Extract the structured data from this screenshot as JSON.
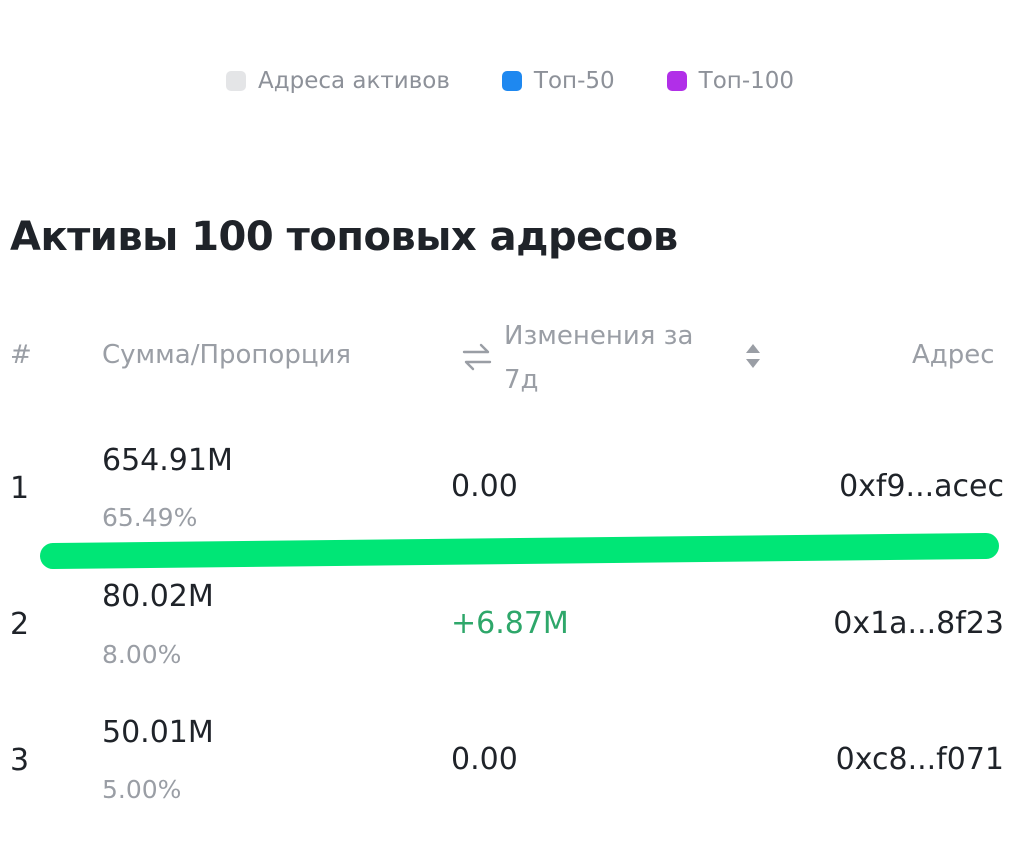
{
  "legend": {
    "items": [
      {
        "label": "Адреса активов",
        "color": "#e4e5e7"
      },
      {
        "label": "Топ-50",
        "color": "#1e88f0"
      },
      {
        "label": "Топ-100",
        "color": "#b12fe8"
      }
    ]
  },
  "section": {
    "title": "Активы 100 топовых адресов"
  },
  "table": {
    "headers": {
      "num": "#",
      "sum": "Сумма/Пропорция",
      "change": "Изменения за 7д",
      "address": "Адрес"
    },
    "rows": [
      {
        "rank": "1",
        "amount": "654.91M",
        "percent": "65.49%",
        "change": "0.00",
        "address": "0xf9...acec"
      },
      {
        "rank": "2",
        "amount": "80.02M",
        "percent": "8.00%",
        "change": "+6.87M",
        "address": "0x1a...8f23"
      },
      {
        "rank": "3",
        "amount": "50.01M",
        "percent": "5.00%",
        "change": "0.00",
        "address": "0xc8...f071"
      }
    ]
  },
  "colors": {
    "positive": "#2ea76a",
    "highlight": "#00e676"
  }
}
